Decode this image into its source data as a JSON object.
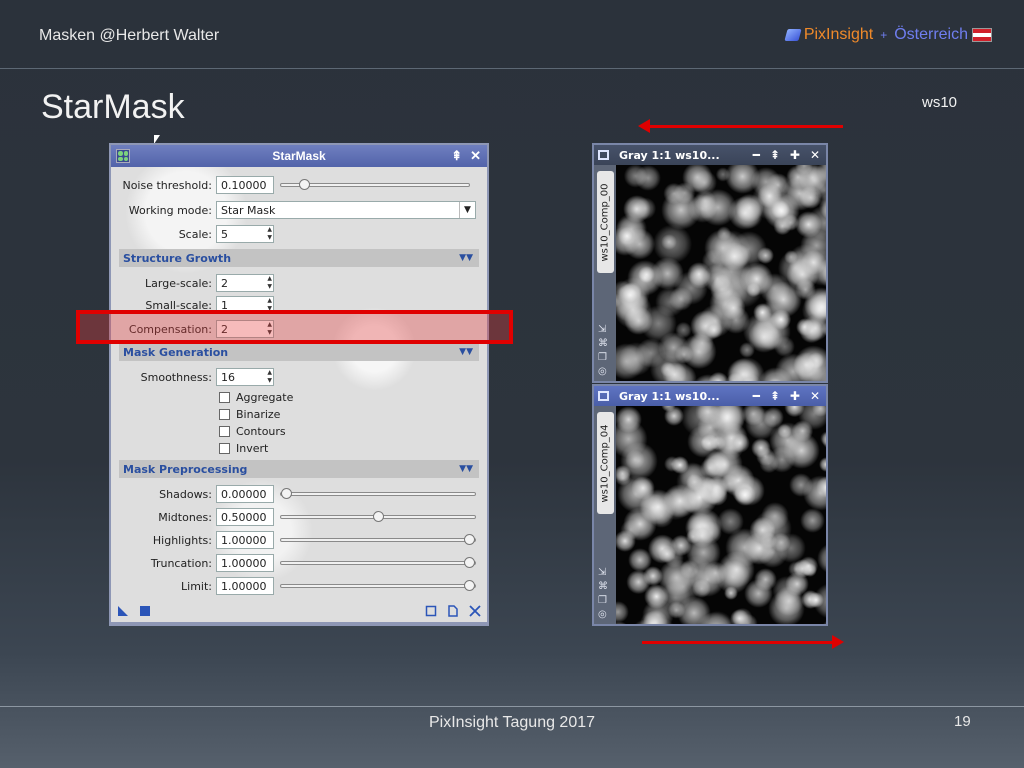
{
  "header": {
    "left_title": "Masken  @Herbert Walter",
    "brand_name": "PixInsight",
    "brand_region": "Österreich",
    "brand_separator": "+"
  },
  "slide": {
    "title": "StarMask",
    "ws_label": "ws10",
    "footer": "PixInsight Tagung 2017",
    "page_number": "19"
  },
  "dialog": {
    "title": "StarMask",
    "title_buttons": [
      "⇞",
      "✕"
    ],
    "noise_threshold": {
      "label": "Noise threshold:",
      "value": "0.10000",
      "slider_fraction": 0.1
    },
    "working_mode": {
      "label": "Working mode:",
      "value": "Star Mask"
    },
    "scale": {
      "label": "Scale:",
      "value": "5"
    },
    "structure_growth": {
      "title": "Structure Growth",
      "large_scale": {
        "label": "Large-scale:",
        "value": "2"
      },
      "small_scale": {
        "label": "Small-scale:",
        "value": "1"
      },
      "compensation": {
        "label": "Compensation:",
        "value": "2"
      }
    },
    "mask_generation": {
      "title": "Mask Generation",
      "smoothness": {
        "label": "Smoothness:",
        "value": "16"
      },
      "checkboxes": [
        "Aggregate",
        "Binarize",
        "Contours",
        "Invert"
      ]
    },
    "mask_preprocessing": {
      "title": "Mask Preprocessing",
      "shadows": {
        "label": "Shadows:",
        "value": "0.00000",
        "slider_fraction": 0.0
      },
      "midtones": {
        "label": "Midtones:",
        "value": "0.50000",
        "slider_fraction": 0.5
      },
      "highlights": {
        "label": "Highlights:",
        "value": "1.00000",
        "slider_fraction": 1.0
      },
      "truncation": {
        "label": "Truncation:",
        "value": "1.00000",
        "slider_fraction": 1.0
      },
      "limit": {
        "label": "Limit:",
        "value": "1.00000",
        "slider_fraction": 1.0
      }
    }
  },
  "image_windows": [
    {
      "title": "Gray 1:1 ws10...",
      "tab": "ws10_Comp_00"
    },
    {
      "title": "Gray 1:1 ws10...",
      "tab": "ws10_Comp_04"
    }
  ],
  "colors": {
    "highlight": "#e00000",
    "section_text": "#2a4fa0",
    "brand_orange": "#f08a2a",
    "brand_blue": "#6f7ef0"
  }
}
